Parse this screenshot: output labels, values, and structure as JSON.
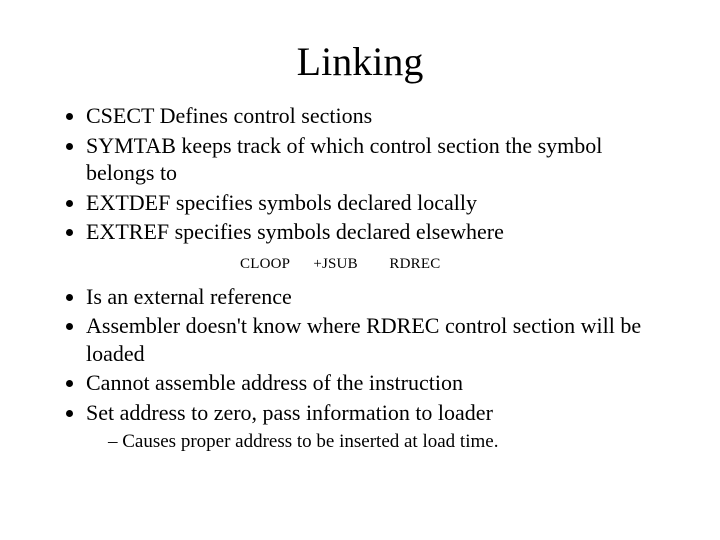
{
  "title": "Linking",
  "bullets_a": [
    "CSECT Defines control sections",
    "SYMTAB keeps track of which control section the symbol belongs to",
    "EXTDEF specifies symbols declared locally",
    "EXTREF specifies symbols declared elsewhere"
  ],
  "code_line": "CLOOP      +JSUB        RDREC",
  "bullets_b": [
    "Is an external reference",
    "Assembler doesn't know where RDREC control section will be loaded",
    "Cannot assemble address of the instruction",
    "Set address to zero, pass information to loader"
  ],
  "sub_bullets": [
    "Causes proper address to be inserted at load time."
  ]
}
